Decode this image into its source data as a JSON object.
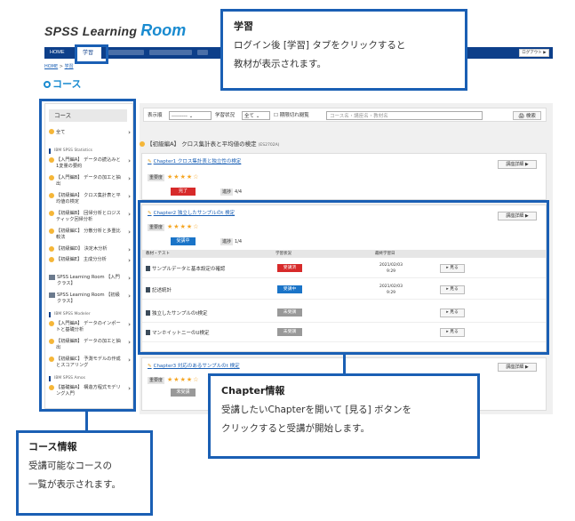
{
  "app": {
    "logo_part1": "SPSS Learning",
    "logo_part2": "Room"
  },
  "nav": {
    "home": "HOME",
    "study": "学習",
    "logout": "ログアウト ▶"
  },
  "breadcrumb": {
    "home": "HOME",
    "sep": ">",
    "current": "学習"
  },
  "page_title": "コース",
  "sidebar": {
    "title": "コース",
    "all": "全て",
    "sections": [
      "IBM SPSS Statistics",
      "IBM SPSS Modeler",
      "IBM SPSS Amos"
    ],
    "items": [
      "【入門編A】 データの読込みと1変量の要約",
      "【入門編B】 データの加工と抽出",
      "【初級編A】 クロス集計表と平均値の検定",
      "【初級編B】 回帰分析とロジスティック回帰分析",
      "【初級編C】 分散分析と多重比較法",
      "【初級編D】 決定木分析",
      "【初級編E】 主成分分析",
      "SPSS Learning Room 【入門クラス】",
      "SPSS Learning Room 【初級クラス】",
      "【入門編A】 データのインポートと基礎分析",
      "【初級編B】 データの加工と抽出",
      "【初級編C】 予測モデルの作成とスコアリング",
      "【基礎編A】 構造方程式モデリング入門"
    ]
  },
  "search": {
    "sort_label": "表示順",
    "sort_value": "---------",
    "status_label": "学習状況",
    "status_value": "全て",
    "expired_label": "期限切れ閲覧",
    "placeholder": "コース名・講座名・教材名",
    "search_button": "検索"
  },
  "course": {
    "title": "【初級編A】 クロス集計表と平均値の検定",
    "code": "(ES2702A)"
  },
  "labels": {
    "importance": "重要度",
    "progress": "進捗",
    "detail": "講座詳細 ▶",
    "col_material": "教材・テスト",
    "col_status": "学習状況",
    "col_last": "最終学習日",
    "view": "見る"
  },
  "chapters": [
    {
      "title": "Chapter1 クロス集計表と独立性の検定",
      "stars": "★★★★☆",
      "status": "完了",
      "progress": "4/4"
    },
    {
      "title": "Chapter2 独立したサンプルのt 検定",
      "stars": "★★★★☆",
      "status": "受講中",
      "progress": "1/4"
    },
    {
      "title": "Chapter3 対応のあるサンプルのt 検定",
      "stars": "★★★★☆",
      "status": "未受講"
    }
  ],
  "materials": [
    {
      "name": "サンプルデータと基本設定の確認",
      "status": "受講済",
      "date": "2021/02/03",
      "time": "9:29"
    },
    {
      "name": "記述統計",
      "status": "受講中",
      "date": "2021/02/03",
      "time": "9:29"
    },
    {
      "name": "独立したサンプルのt検定",
      "status": "未受講",
      "date": "",
      "time": ""
    },
    {
      "name": "マンホイットニーのU検定",
      "status": "未受講",
      "date": "",
      "time": ""
    }
  ],
  "callouts": {
    "study": {
      "title": "学習",
      "line1": "ログイン後 [学習] タブをクリックすると",
      "line2": "教材が表示されます。"
    },
    "course": {
      "title": "コース情報",
      "line1": "受講可能なコースの",
      "line2": "一覧が表示されます。"
    },
    "chapter": {
      "title": "Chapter情報",
      "line1": "受講したいChapterを開いて [見る] ボタンを",
      "line2": "クリックすると受講が開始します。"
    }
  },
  "colors": {
    "accent": "#1a5fb4",
    "nav": "#0d3f8a",
    "done": "#d72a2a",
    "active": "#1a74c8",
    "pending": "#999999"
  }
}
